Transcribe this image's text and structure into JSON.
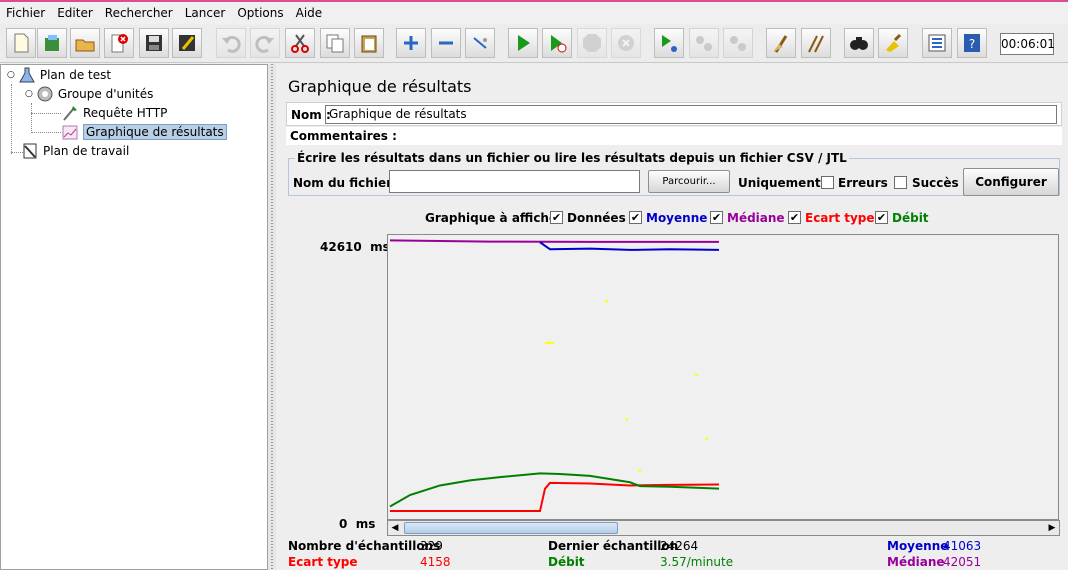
{
  "menu": [
    "Fichier",
    "Editer",
    "Rechercher",
    "Lancer",
    "Options",
    "Aide"
  ],
  "toolbar": {
    "icons": [
      "new-icon",
      "templates-icon",
      "open-icon",
      "close-icon",
      "save-icon",
      "save-as-icon",
      "undo-icon",
      "redo-icon",
      "cut-icon",
      "copy-icon",
      "paste-icon",
      "expand-icon",
      "collapse-icon",
      "toggle-icon",
      "start-icon",
      "start-no-pause-icon",
      "stop-icon",
      "shutdown-icon",
      "remote-start-icon",
      "remote-stop-icon",
      "remote-shutdown-icon",
      "clear-icon",
      "clear-all-icon",
      "search-icon",
      "reset-search-icon",
      "function-helper-icon",
      "help-icon"
    ],
    "timer": "00:06:01"
  },
  "tree": {
    "items": [
      {
        "label": "Plan de test",
        "icon": "test-plan-icon"
      },
      {
        "label": "Groupe d'unités",
        "icon": "thread-group-icon"
      },
      {
        "label": "Requête HTTP",
        "icon": "http-request-icon"
      },
      {
        "label": "Graphique de résultats",
        "icon": "graph-results-icon"
      },
      {
        "label": "Plan de travail",
        "icon": "workbench-icon"
      }
    ]
  },
  "panel": {
    "title": "Graphique de résultats",
    "name_label": "Nom :",
    "name_value": "Graphique de résultats",
    "comments_label": "Commentaires :",
    "file_legend": "Écrire les résultats dans un fichier ou lire les résultats depuis un fichier CSV / JTL",
    "file_label": "Nom du fichier :",
    "file_value": "",
    "browse_label": "Parcourir...",
    "only_label": "Uniquement :",
    "errors_label": "Erreurs",
    "success_label": "Succès",
    "configure_label": "Configurer"
  },
  "graph_options": {
    "label": "Graphique à afficher",
    "items": [
      {
        "label": "Données",
        "checked": true,
        "color": "#000000"
      },
      {
        "label": "Moyenne",
        "checked": true,
        "color": "#0000cc"
      },
      {
        "label": "Médiane",
        "checked": true,
        "color": "#990099"
      },
      {
        "label": "Ecart type",
        "checked": true,
        "color": "#ff0000"
      },
      {
        "label": "Débit",
        "checked": true,
        "color": "#008000"
      }
    ]
  },
  "chart_data": {
    "type": "line",
    "ylim": [
      0,
      42610
    ],
    "y_top_label": "42610",
    "y_bottom_label": "0",
    "y_unit": "ms",
    "grid": false,
    "series": [
      {
        "name": "Médiane",
        "color": "#990099",
        "x": [
          0,
          100,
          200,
          329
        ],
        "values": [
          42400,
          42200,
          42150,
          42150
        ]
      },
      {
        "name": "Moyenne",
        "color": "#0000cc",
        "x": [
          150,
          160,
          200,
          240,
          280,
          329
        ],
        "values": [
          42100,
          41000,
          41100,
          40900,
          41000,
          40900
        ]
      },
      {
        "name": "Ecart type",
        "color": "#ff0000",
        "x": [
          0,
          150,
          155,
          160,
          200,
          240,
          280,
          329
        ],
        "values": [
          0,
          0,
          3500,
          4400,
          4300,
          4000,
          4100,
          4158
        ]
      },
      {
        "name": "Débit",
        "color": "#008000",
        "x": [
          0,
          20,
          50,
          80,
          110,
          150,
          170,
          200,
          240,
          250,
          280,
          329
        ],
        "values": [
          700,
          2500,
          4000,
          4800,
          5300,
          5900,
          5800,
          5500,
          4500,
          3900,
          3800,
          3500
        ]
      },
      {
        "name": "Données",
        "color": "#ffff00",
        "x": [
          215,
          155,
          305,
          235,
          315,
          248
        ],
        "values": [
          33000,
          26500,
          21500,
          14500,
          11500,
          6500
        ]
      }
    ]
  },
  "stats": {
    "samples_label": "Nombre d'échantillons",
    "samples_value": "329",
    "last_label": "Dernier échantillon",
    "last_value": "24264",
    "average_label": "Moyenne",
    "average_value": "41063",
    "deviation_label": "Ecart type",
    "deviation_value": "4158",
    "throughput_label": "Débit",
    "throughput_value": "3.57/minute",
    "median_label": "Médiane",
    "median_value": "42051"
  }
}
